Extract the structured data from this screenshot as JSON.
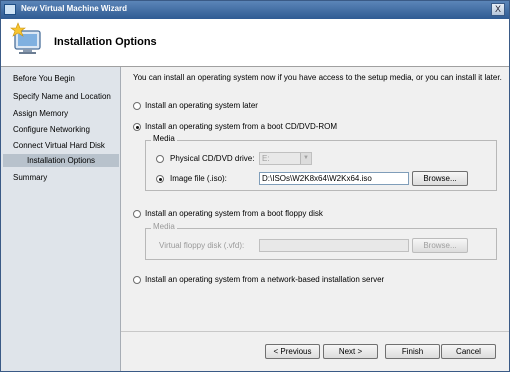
{
  "window": {
    "title": "New Virtual Machine Wizard",
    "close_glyph": "X"
  },
  "header": {
    "title": "Installation Options"
  },
  "nav": {
    "items": [
      {
        "label": "Before You Begin"
      },
      {
        "label": "Specify Name and Location"
      },
      {
        "label": "Assign Memory"
      },
      {
        "label": "Configure Networking"
      },
      {
        "label": "Connect Virtual Hard Disk"
      },
      {
        "label": "Installation Options",
        "selected": true
      },
      {
        "label": "Summary"
      }
    ]
  },
  "main": {
    "intro": "You can install an operating system now if you have access to the setup media, or you can install it later.",
    "options": [
      {
        "label": "Install an operating system later",
        "selected": false
      },
      {
        "label": "Install an operating system from a boot CD/DVD-ROM",
        "selected": true
      },
      {
        "label": "Install an operating system from a boot floppy disk",
        "selected": false
      },
      {
        "label": "Install an operating system from a network-based installation server",
        "selected": false
      }
    ],
    "cd_media": {
      "legend": "Media",
      "physical_label": "Physical CD/DVD drive:",
      "physical_value": "E:",
      "image_label": "Image file (.iso):",
      "image_value": "D:\\ISOs\\W2K8x64\\W2Kx64.iso",
      "browse_label": "Browse..."
    },
    "floppy_media": {
      "legend": "Media",
      "floppy_label": "Virtual floppy disk (.vfd):",
      "floppy_value": "",
      "browse_label": "Browse..."
    }
  },
  "buttons": {
    "previous": "< Previous",
    "next": "Next >",
    "finish": "Finish",
    "cancel": "Cancel"
  },
  "colors": {
    "titlebar": "#2f5b93",
    "nav_bg": "#dfe4ea",
    "nav_selected": "#b8c2cc"
  },
  "icons": {
    "window": "wizard-window-icon",
    "header": "monitor-star-icon",
    "dropdown": "chevron-down-icon"
  }
}
